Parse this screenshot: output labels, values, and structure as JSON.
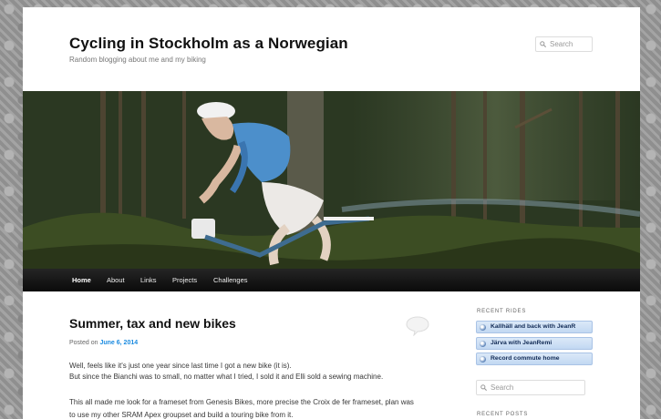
{
  "site": {
    "title": "Cycling in Stockholm as a Norwegian",
    "description": "Random blogging about me and my biking"
  },
  "search": {
    "placeholder": "Search",
    "sidebar_placeholder": "Search"
  },
  "nav": {
    "items": [
      {
        "label": "Home",
        "active": true
      },
      {
        "label": "About",
        "active": false
      },
      {
        "label": "Links",
        "active": false
      },
      {
        "label": "Projects",
        "active": false
      },
      {
        "label": "Challenges",
        "active": false
      }
    ]
  },
  "post": {
    "title": "Summer, tax and new bikes",
    "meta_prefix": "Posted on",
    "date": "June 6, 2014",
    "paragraphs": [
      "Well, feels like it's just one year since last time I got a new bike (it is).",
      "But since the Bianchi was to small, no matter what I tried, I sold it and Elli sold a sewing machine.",
      "This all made me look for a frameset from Genesis Bikes, more precise the Croix de fer frameset, plan was",
      "to use my other SRAM Apex groupset and build a touring bike from it."
    ]
  },
  "sidebar": {
    "recent_rides_title": "RECENT RIDES",
    "rides": [
      "Kallhäll and back with JeanR",
      "Järva with JeanRemi",
      "Record commute home"
    ],
    "recent_posts_title": "RECENT POSTS"
  },
  "colors": {
    "link": "#1b8be0",
    "nav_bg": "#111111",
    "ride_bg": "#c8dbf3"
  }
}
